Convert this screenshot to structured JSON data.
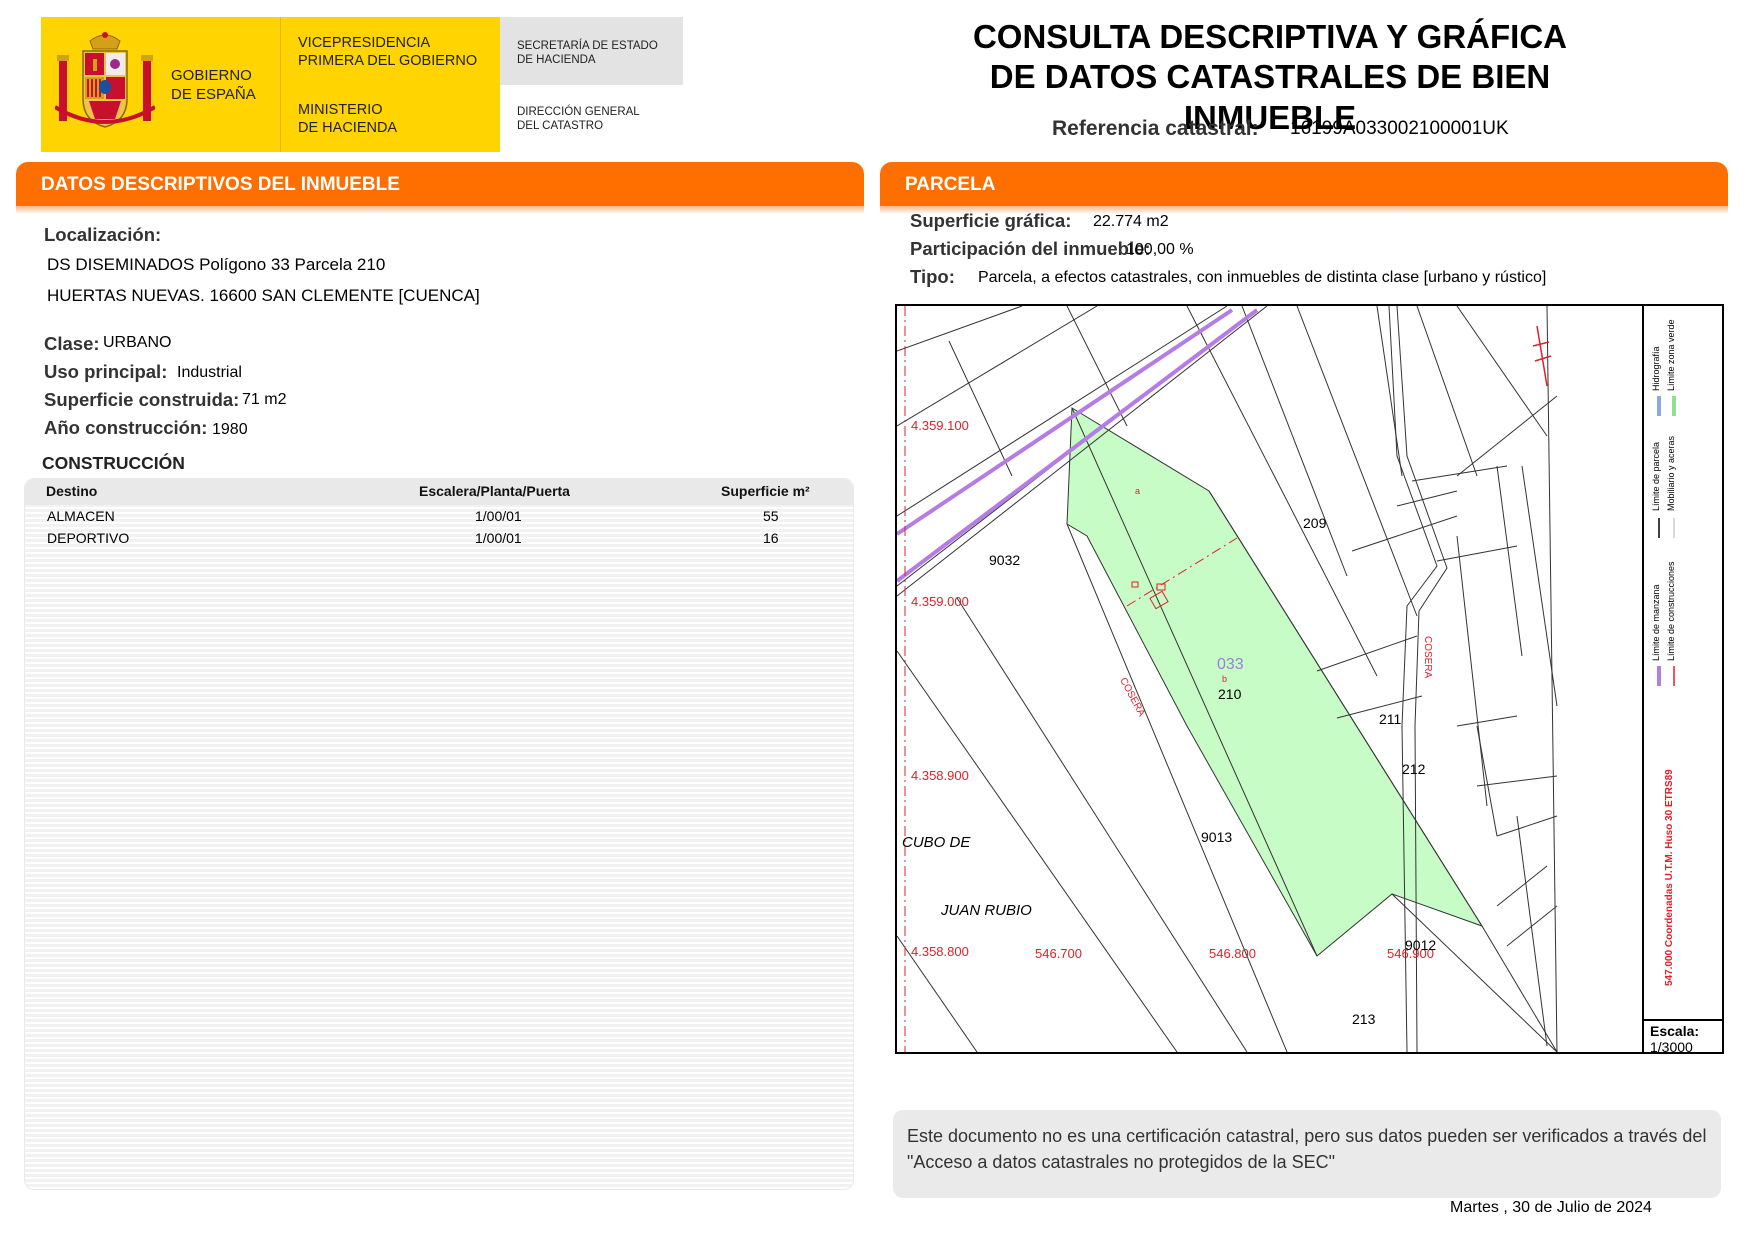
{
  "header": {
    "gobierno": "GOBIERNO\nDE ESPAÑA",
    "vicepresidencia": "VICEPRESIDENCIA\nPRIMERA DEL GOBIERNO",
    "ministerio": "MINISTERIO\nDE HACIENDA",
    "secretaria": "SECRETARÍA DE ESTADO\nDE HACIENDA",
    "direccion": "DIRECCIÓN GENERAL\nDEL CATASTRO",
    "title_line1": "CONSULTA DESCRIPTIVA Y GRÁFICA",
    "title_line2": "DE DATOS CATASTRALES DE BIEN INMUEBLE",
    "refcat_label": "Referencia catastral:",
    "refcat_value": "16199A033002100001UK",
    "colors": {
      "brand_yellow": "#ffd400",
      "accent_orange": "#ff6f00"
    }
  },
  "descriptivos": {
    "section_title": "DATOS DESCRIPTIVOS DEL INMUEBLE",
    "localizacion_label": "Localización:",
    "localizacion_line1": "DS DISEMINADOS  Polígono 33 Parcela 210",
    "localizacion_line2": "HUERTAS NUEVAS. 16600 SAN CLEMENTE [CUENCA]",
    "clase_label": "Clase:",
    "clase_value": "URBANO",
    "uso_label": "Uso principal:",
    "uso_value": "Industrial",
    "superficie_label": "Superficie construida:",
    "superficie_value": "71 m2",
    "anio_label": "Año construcción:",
    "anio_value": "1980",
    "construccion_title": "CONSTRUCCIÓN",
    "table": {
      "headers": [
        "Destino",
        "Escalera/Planta/Puerta",
        "Superficie m²"
      ],
      "rows": [
        [
          "ALMACEN",
          "1/00/01",
          "55"
        ],
        [
          "DEPORTIVO",
          "1/00/01",
          "16"
        ]
      ]
    }
  },
  "parcela": {
    "section_title": "PARCELA",
    "superficie_label": "Superficie gráfica:",
    "superficie_value": "22.774 m2",
    "participacion_label": "Participación del inmueble:",
    "participacion_value": "100,00 %",
    "tipo_label": "Tipo:",
    "tipo_value": "Parcela, a efectos catastrales, con inmuebles de distinta clase [urbano y rústico]",
    "map": {
      "northing": [
        "4.359.100",
        "4.359.000",
        "4.358.900",
        "4.358.800"
      ],
      "easting": [
        "546.700",
        "546.800",
        "546.900"
      ],
      "poligono": "033",
      "parcel_numbers": [
        "209",
        "210",
        "211",
        "212",
        "213",
        "9032",
        "9013",
        "9012"
      ],
      "road_label": "COSERA",
      "place_line1": "CUBO DE",
      "place_line2": "JUAN RUBIO",
      "sub_a": "a",
      "sub_b": "b",
      "legend": [
        "Límite de manzana",
        "Límite de parcela",
        "Hidrografía",
        "Límite de construcciones",
        "Mobiliario y aceras",
        "Límite zona verde"
      ],
      "coords_note": "547.000 Coordenadas U.T.M. Huso 30 ETRS89",
      "escala_label": "Escala:",
      "escala_value": "1/3000"
    },
    "note": "Este documento no es una certificación catastral, pero sus datos pueden ser verificados a través del \"Acceso a datos catastrales no protegidos de la SEC\"",
    "date": "Martes , 30 de Julio de 2024"
  }
}
